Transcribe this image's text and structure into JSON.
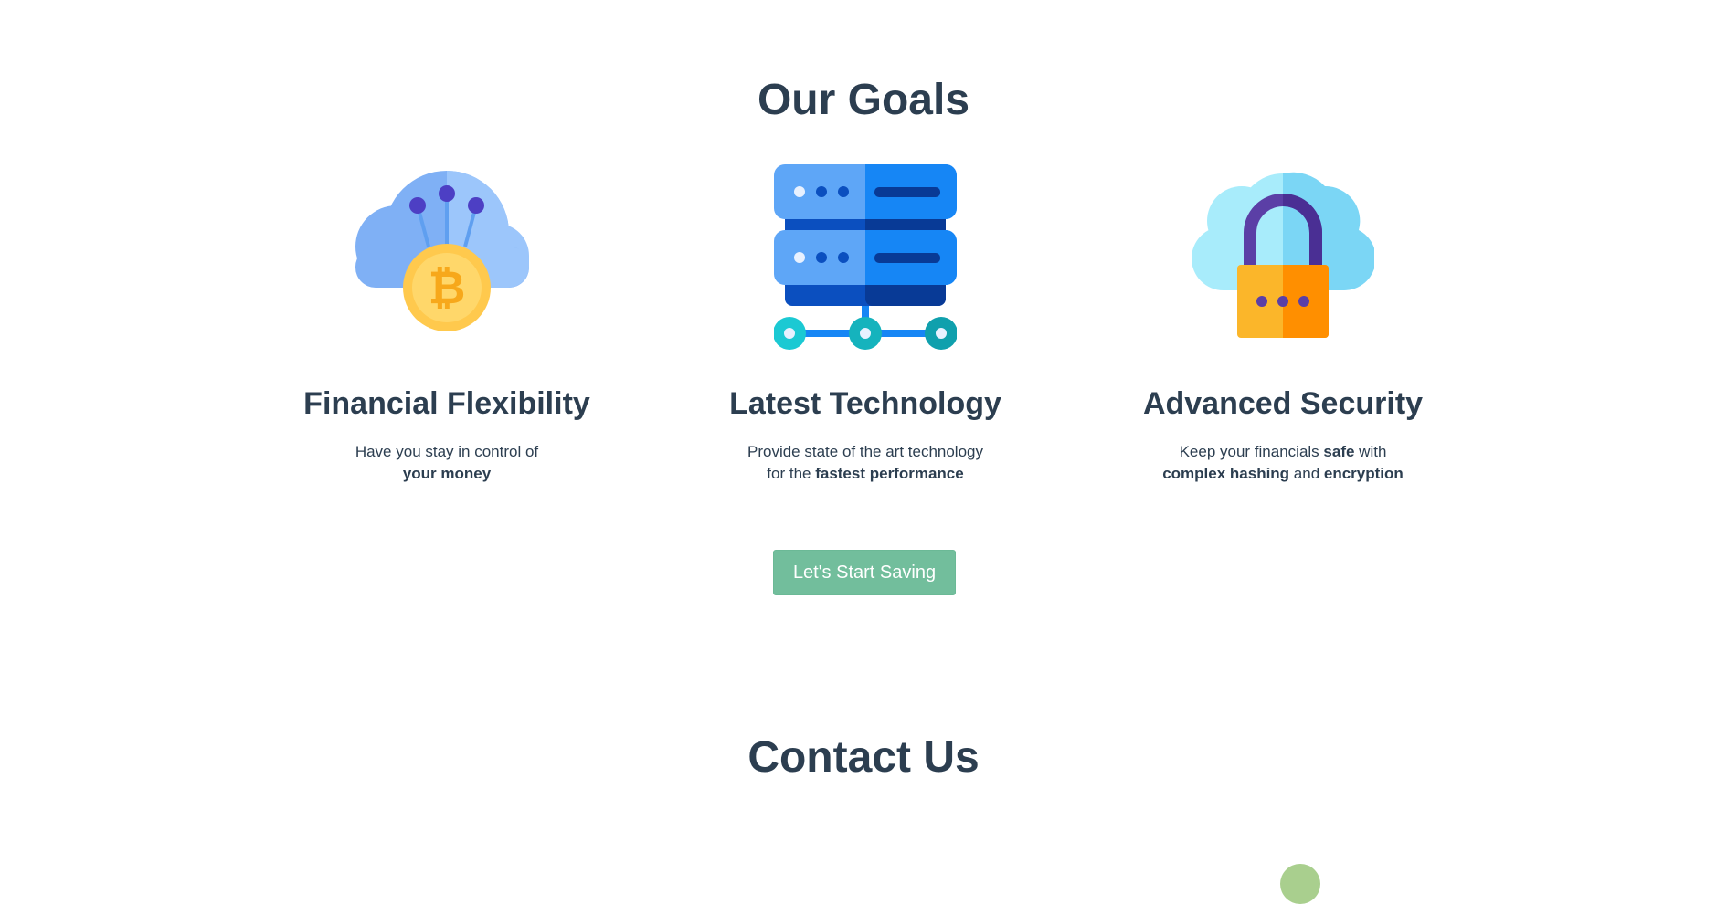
{
  "goals": {
    "title": "Our Goals",
    "items": [
      {
        "icon": "bitcoin-cloud-icon",
        "title": "Financial Flexibility",
        "text": [
          {
            "t": "Have you stay in control of",
            "b": false
          },
          {
            "br": true
          },
          {
            "t": "your money",
            "b": true
          }
        ]
      },
      {
        "icon": "server-network-icon",
        "title": "Latest Technology",
        "text": [
          {
            "t": "Provide state of the art technology",
            "b": false
          },
          {
            "br": true
          },
          {
            "t": "for the ",
            "b": false
          },
          {
            "t": "fastest performance",
            "b": true
          }
        ]
      },
      {
        "icon": "cloud-lock-icon",
        "title": "Advanced Security",
        "text": [
          {
            "t": "Keep your financials ",
            "b": false
          },
          {
            "t": "safe",
            "b": true
          },
          {
            "t": " with",
            "b": false
          },
          {
            "br": true
          },
          {
            "t": "complex hashing",
            "b": true
          },
          {
            "t": " and ",
            "b": false
          },
          {
            "t": "encryption",
            "b": true
          }
        ]
      }
    ]
  },
  "cta": {
    "label": "Let's Start Saving"
  },
  "contact": {
    "title": "Contact Us"
  },
  "colors": {
    "heading": "#2c3e50",
    "button": "#72be9c",
    "decoration": "#a9cf8e"
  }
}
